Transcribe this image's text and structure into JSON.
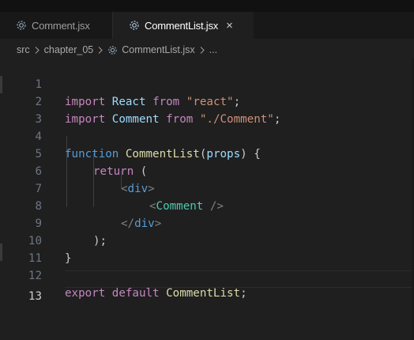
{
  "tabs": [
    {
      "label": "Comment.jsx",
      "active": false,
      "icon": "react-gear-icon"
    },
    {
      "label": "CommentList.jsx",
      "active": true,
      "icon": "react-gear-icon",
      "close": "×"
    }
  ],
  "breadcrumb": {
    "items": [
      "src",
      "chapter_05",
      "CommentList.jsx",
      "..."
    ]
  },
  "editor": {
    "line_numbers": [
      "1",
      "2",
      "3",
      "4",
      "5",
      "6",
      "7",
      "8",
      "9",
      "10",
      "11",
      "12",
      "13"
    ],
    "current_line": "13",
    "lines": [
      {
        "t1": "import",
        "t2": " ",
        "t3": "React",
        "t4": " ",
        "t5": "from",
        "t6": " ",
        "t7": "\"react\"",
        "t8": ";"
      },
      {
        "t1": "import",
        "t2": " ",
        "t3": "Comment",
        "t4": " ",
        "t5": "from",
        "t6": " ",
        "t7": "\"./Comment\"",
        "t8": ";"
      },
      {},
      {
        "t1": "function",
        "t2": " ",
        "t3": "CommentList",
        "t4": "(",
        "t5": "props",
        "t6": ") {"
      },
      {
        "t1": "return",
        "t2": " ("
      },
      {
        "t1": "<",
        "t2": "div",
        "t3": ">"
      },
      {
        "t1": "<",
        "t2": "Comment",
        "t3": " />"
      },
      {
        "t1": "</",
        "t2": "div",
        "t3": ">"
      },
      {
        "t1": ");"
      },
      {
        "t1": "}"
      },
      {},
      {
        "t1": "export",
        "t2": " ",
        "t3": "default",
        "t4": " ",
        "t5": "CommentList",
        "t6": ";"
      },
      {}
    ]
  },
  "colors": {
    "background": "#1f1f1f",
    "keyword": "#c586c0",
    "builtin_keyword": "#569cd6",
    "variable": "#9cdcfe",
    "function": "#dcdcaa",
    "string": "#ce9178",
    "component": "#4ec9b0"
  }
}
